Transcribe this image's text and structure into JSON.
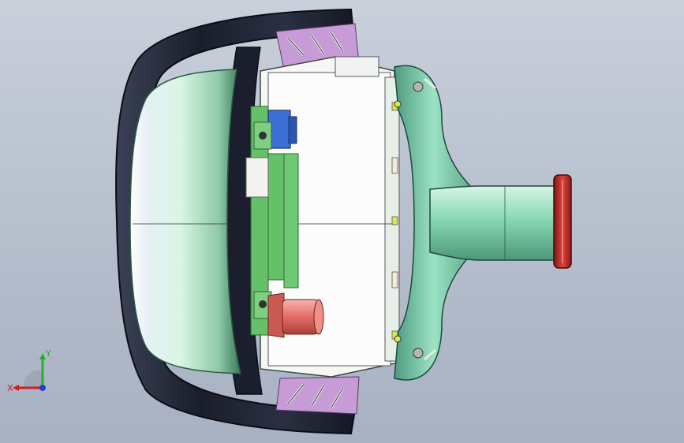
{
  "viewport": {
    "background_top": "#c9d0db",
    "background_bottom": "#a8b1c2"
  },
  "model": {
    "parts": [
      "outer-rim-housing",
      "lens-cover",
      "circuit-board-assembly",
      "blue-connector",
      "red-cylinder-connector",
      "green-mounting-bracket",
      "flange-pipe",
      "red-flange"
    ],
    "colors": {
      "rim": "#1e2233",
      "lens": "#d8f5e8",
      "board": "#f4f7f4",
      "pcb_green": "#5fbf5f",
      "blue_connector": "#3d6fd6",
      "red_cylinder": "#e0706a",
      "bracket": "#7ed4b0",
      "flange": "#c9302c",
      "clip_purple": "#b784c9"
    }
  },
  "triad": {
    "x_label": "X",
    "y_label": "Y",
    "x_color": "#d21e1e",
    "y_color": "#25b025",
    "z_color": "#2040d0"
  }
}
